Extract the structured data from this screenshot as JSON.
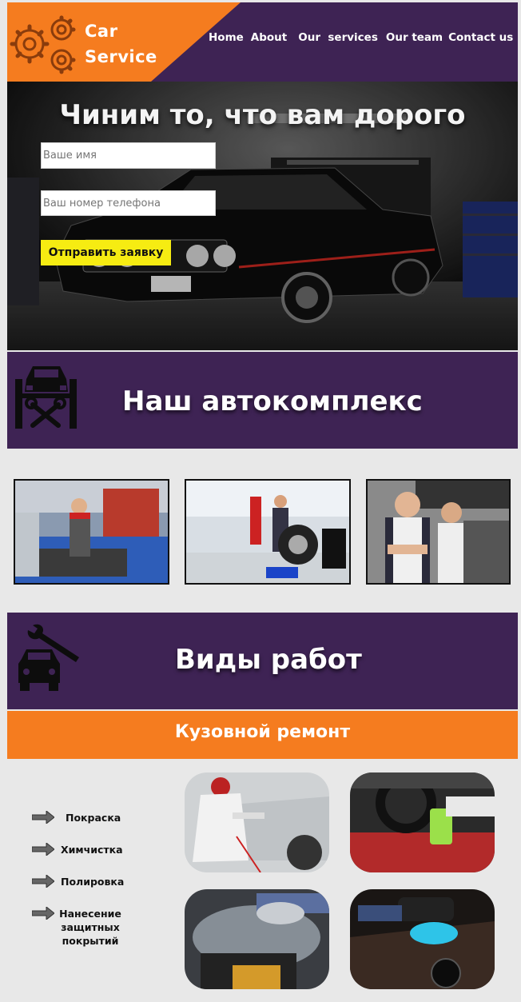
{
  "header": {
    "logo_line1": "Car",
    "logo_line2": "Service",
    "nav": [
      "Home",
      "About",
      "Our  services",
      "Our team",
      "Contact us"
    ],
    "colors": {
      "purple": "#3e2354",
      "orange": "#f57c1f"
    }
  },
  "hero": {
    "title": "Чиним то, что вам дорого",
    "name_placeholder": "Ваше имя",
    "phone_placeholder": "Ваш номер телефона",
    "submit_label": "Отправить заявку",
    "submit_color": "#f6ec12"
  },
  "complex": {
    "icon": "car-lift-tools-icon",
    "title": "Наш автокомплекс",
    "photos": [
      "mechanic-engine-photo",
      "tire-service-photo",
      "mechanics-team-photo"
    ]
  },
  "works": {
    "icon": "car-wrench-icon",
    "title": "Виды работ",
    "subsection_title": "Кузовной ремонт",
    "items": [
      "Покраска",
      "Химчистка",
      "Полировка",
      "Нанесение защитных покрытий"
    ],
    "item_icon": "arrow-right-icon",
    "photos": [
      "car-painting-photo",
      "interior-cleaning-photo",
      "steam-cleaning-photo",
      "car-polishing-photo"
    ]
  }
}
